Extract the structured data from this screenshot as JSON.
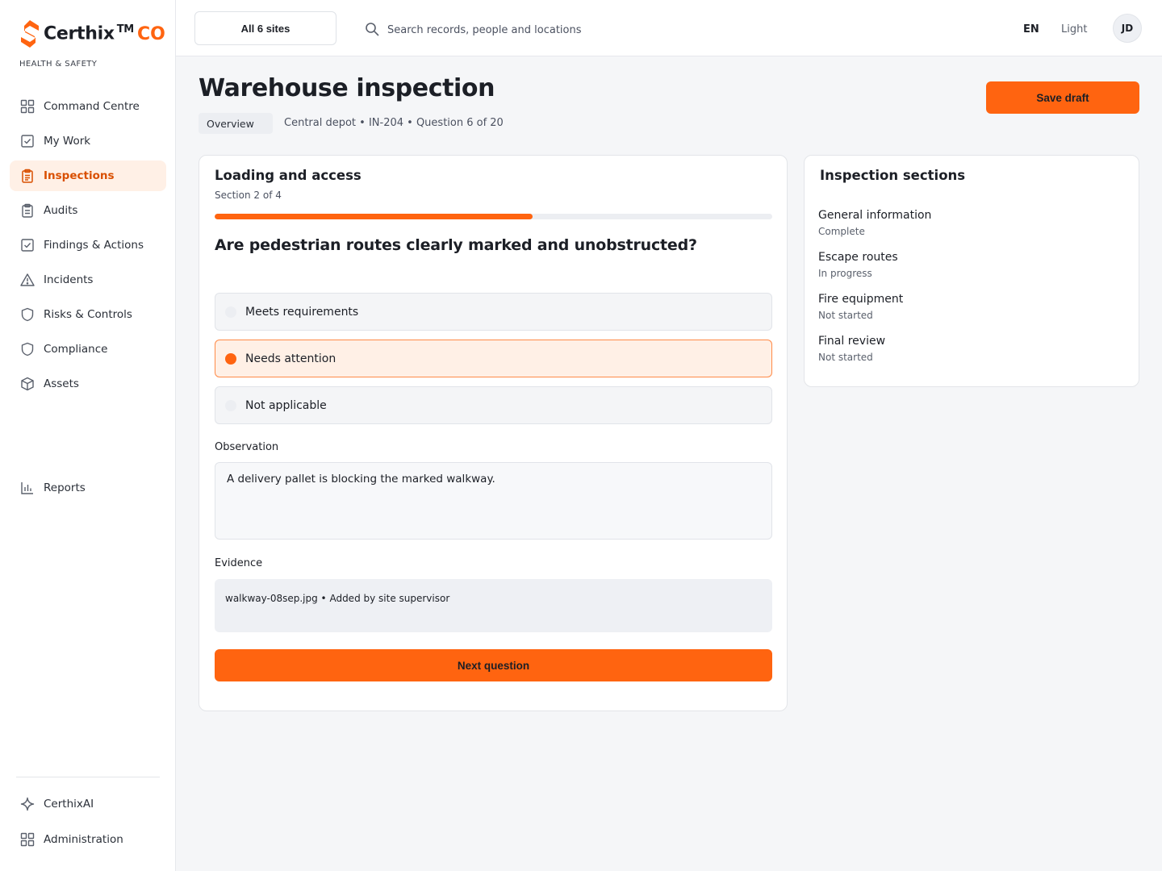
{
  "brand": {
    "name": "Certhix",
    "tm": "TM",
    "suffix": "CO",
    "tagline": "HEALTH & SAFETY",
    "accent": "#ff6410"
  },
  "sidebar": {
    "items": [
      {
        "label": "Command Centre",
        "icon": "grid-icon"
      },
      {
        "label": "My Work",
        "icon": "checkbox-icon"
      },
      {
        "label": "Inspections",
        "icon": "clipboard-icon",
        "active": true
      },
      {
        "label": "Audits",
        "icon": "clipboard-list-icon"
      },
      {
        "label": "Findings & Actions",
        "icon": "checkbox-icon"
      },
      {
        "label": "Incidents",
        "icon": "warning-icon"
      },
      {
        "label": "Risks & Controls",
        "icon": "shield-icon"
      },
      {
        "label": "Compliance",
        "icon": "shield-icon"
      },
      {
        "label": "Assets",
        "icon": "cube-icon"
      },
      {
        "label": "Reports",
        "icon": "bar-chart-icon"
      }
    ],
    "footer": [
      {
        "label": "CerthixAI",
        "icon": "sparkle-icon"
      },
      {
        "label": "Administration",
        "icon": "grid-icon"
      }
    ]
  },
  "topbar": {
    "site_selector": "All 6 sites",
    "search_placeholder": "Search records, people and locations",
    "language": "EN",
    "theme": "Light",
    "avatar_initials": "JD"
  },
  "header": {
    "title": "Warehouse inspection",
    "tab": "Overview",
    "meta": "Central depot • IN-204 • Question 6 of 20",
    "save_label": "Save draft"
  },
  "form": {
    "section_title": "Loading and access",
    "section_sub": "Section 2 of 4",
    "progress": 0.57,
    "question": "Are pedestrian routes clearly marked and unobstructed?",
    "options": [
      {
        "label": "Meets requirements",
        "selected": false
      },
      {
        "label": "Needs attention",
        "selected": true
      },
      {
        "label": "Not applicable",
        "selected": false
      }
    ],
    "observation_label": "Observation",
    "observation_value": "A delivery pallet is blocking the marked walkway.",
    "evidence_label": "Evidence",
    "evidence_value": "walkway-08sep.jpg • Added by site supervisor",
    "next_label": "Next question"
  },
  "sections": {
    "title": "Inspection sections",
    "items": [
      {
        "name": "General information",
        "status": "Complete"
      },
      {
        "name": "Escape routes",
        "status": "In progress"
      },
      {
        "name": "Fire equipment",
        "status": "Not started"
      },
      {
        "name": "Final review",
        "status": "Not started"
      }
    ]
  }
}
